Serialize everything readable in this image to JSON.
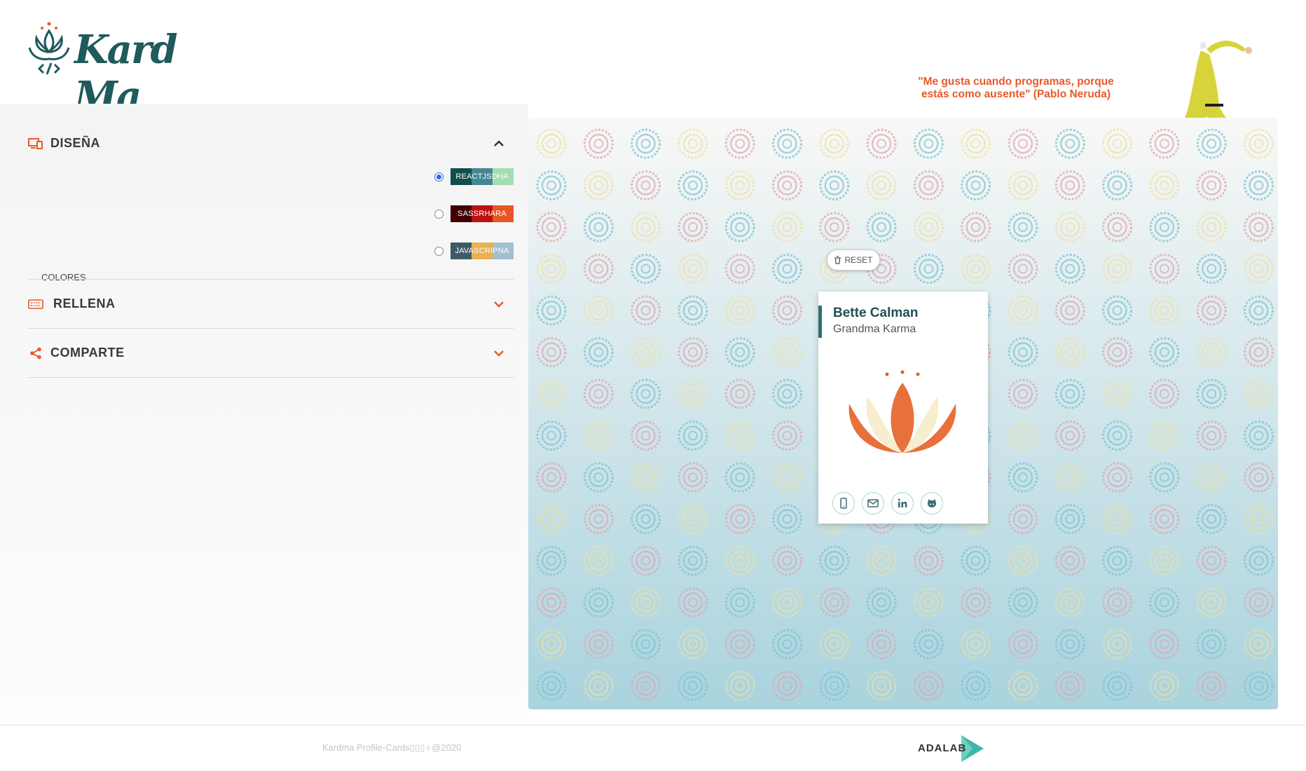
{
  "header": {
    "logo_text": "Kard Ma",
    "quote": "\"Me gusta cuando programas, porque estás como ausente\" (Pablo Neruda)"
  },
  "design": {
    "title": "DISEÑA",
    "colors_label": "COLORES",
    "palettes": [
      {
        "label": "REACTJSDHA",
        "colors": [
          "#114e4e",
          "#438792",
          "#a2deaf"
        ],
        "selected": true
      },
      {
        "label": "SASSRHARA",
        "colors": [
          "#420101",
          "#bd1010",
          "#e95626"
        ],
        "selected": false
      },
      {
        "label": "JAVASCRIPNA",
        "colors": [
          "#3e5b65",
          "#eab052",
          "#a0c0cf"
        ],
        "selected": false
      }
    ]
  },
  "fill": {
    "title": "RELLENA"
  },
  "share": {
    "title": "COMPARTE"
  },
  "preview": {
    "reset_label": "RESET",
    "card": {
      "name": "Bette Calman",
      "job": "Grandma Karma"
    },
    "social_icons": [
      "phone-icon",
      "email-icon",
      "linkedin-icon",
      "github-icon"
    ]
  },
  "footer": {
    "copyright": "Kardma Profile-Cards▯▯▯♀@2020",
    "brand": "ADALAB"
  },
  "colors": {
    "accent": "#e85a29",
    "brand_teal": "#1f5a5d",
    "pattern_pink": "#e0a6b1",
    "pattern_teal": "#7cc4d2",
    "pattern_yellow": "#efe0a3"
  }
}
